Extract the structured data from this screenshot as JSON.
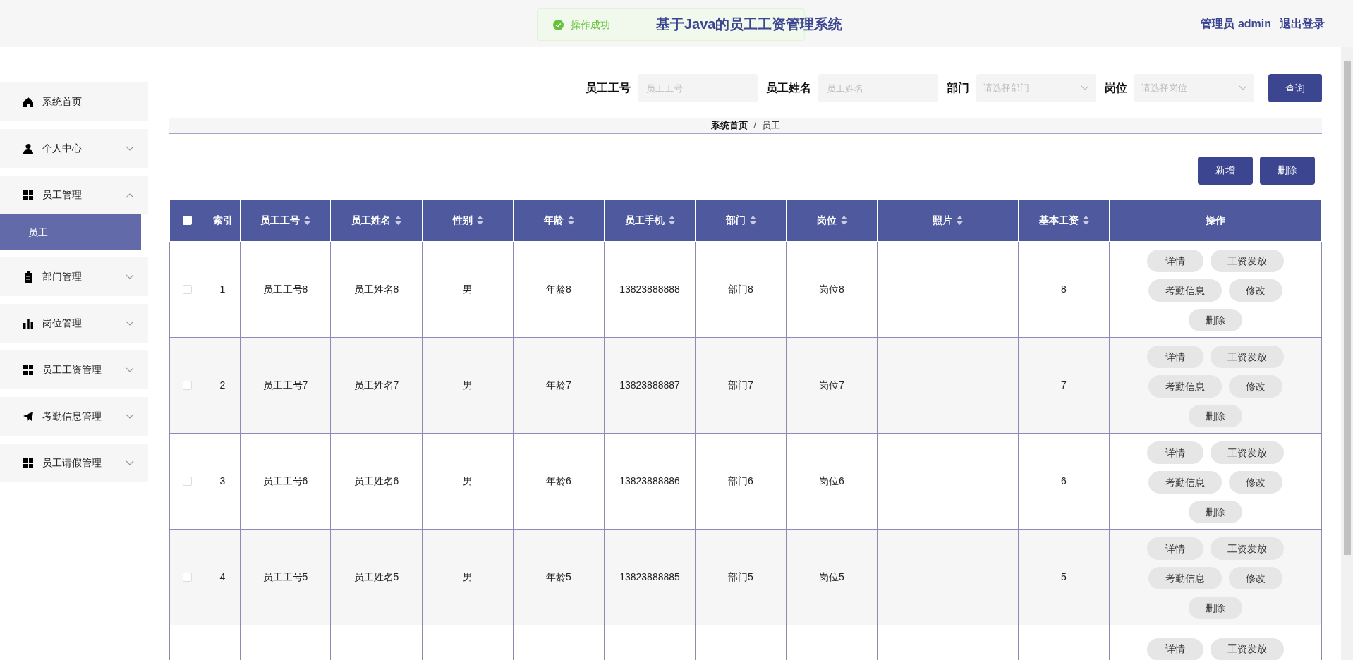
{
  "header": {
    "title": "基于Java的员工工资管理系统",
    "user": "管理员 admin",
    "logout": "退出登录"
  },
  "toast": {
    "text": "操作成功"
  },
  "sidebar": {
    "items": [
      {
        "label": "系统首页",
        "kind": "link"
      },
      {
        "label": "个人中心",
        "kind": "group",
        "expanded": false
      },
      {
        "label": "员工管理",
        "kind": "group",
        "expanded": true,
        "children": [
          {
            "label": "员工",
            "selected": true
          }
        ]
      },
      {
        "label": "部门管理",
        "kind": "group",
        "expanded": false
      },
      {
        "label": "岗位管理",
        "kind": "group",
        "expanded": false
      },
      {
        "label": "员工工资管理",
        "kind": "group",
        "expanded": false
      },
      {
        "label": "考勤信息管理",
        "kind": "group",
        "expanded": false
      },
      {
        "label": "员工请假管理",
        "kind": "group",
        "expanded": false
      }
    ]
  },
  "search": {
    "fields": [
      {
        "label": "员工工号",
        "placeholder": "员工工号",
        "kind": "input"
      },
      {
        "label": "员工姓名",
        "placeholder": "员工姓名",
        "kind": "input"
      },
      {
        "label": "部门",
        "placeholder": "请选择部门",
        "kind": "select"
      },
      {
        "label": "岗位",
        "placeholder": "请选择岗位",
        "kind": "select"
      }
    ],
    "button": "查询"
  },
  "breadcrumb": {
    "items": [
      "系统首页",
      "员工"
    ],
    "separator": "/"
  },
  "toolbar": [
    "新增",
    "删除"
  ],
  "table": {
    "header_checked": false,
    "columns": [
      {
        "label": "索引",
        "sortable": false
      },
      {
        "label": "员工工号",
        "sortable": true
      },
      {
        "label": "员工姓名",
        "sortable": true
      },
      {
        "label": "性别",
        "sortable": true
      },
      {
        "label": "年龄",
        "sortable": true
      },
      {
        "label": "员工手机",
        "sortable": true
      },
      {
        "label": "部门",
        "sortable": true
      },
      {
        "label": "岗位",
        "sortable": true
      },
      {
        "label": "照片",
        "sortable": true
      },
      {
        "label": "基本工资",
        "sortable": true
      },
      {
        "label": "操作",
        "sortable": false
      }
    ],
    "rows": [
      {
        "checked": false,
        "cells": [
          "1",
          "员工工号8",
          "员工姓名8",
          "男",
          "年龄8",
          "13823888888",
          "部门8",
          "岗位8",
          "",
          "8"
        ],
        "actions": [
          "详情",
          "工资发放",
          "考勤信息",
          "修改",
          "删除"
        ]
      },
      {
        "checked": false,
        "cells": [
          "2",
          "员工工号7",
          "员工姓名7",
          "男",
          "年龄7",
          "13823888887",
          "部门7",
          "岗位7",
          "",
          "7"
        ],
        "actions": [
          "详情",
          "工资发放",
          "考勤信息",
          "修改",
          "删除"
        ]
      },
      {
        "checked": false,
        "cells": [
          "3",
          "员工工号6",
          "员工姓名6",
          "男",
          "年龄6",
          "13823888886",
          "部门6",
          "岗位6",
          "",
          "6"
        ],
        "actions": [
          "详情",
          "工资发放",
          "考勤信息",
          "修改",
          "删除"
        ]
      },
      {
        "checked": false,
        "cells": [
          "4",
          "员工工号5",
          "员工姓名5",
          "男",
          "年龄5",
          "13823888885",
          "部门5",
          "岗位5",
          "",
          "5"
        ],
        "actions": [
          "详情",
          "工资发放",
          "考勤信息",
          "修改",
          "删除"
        ]
      },
      {
        "cells": [],
        "actions": [
          "详情",
          "工资发放"
        ]
      }
    ]
  }
}
